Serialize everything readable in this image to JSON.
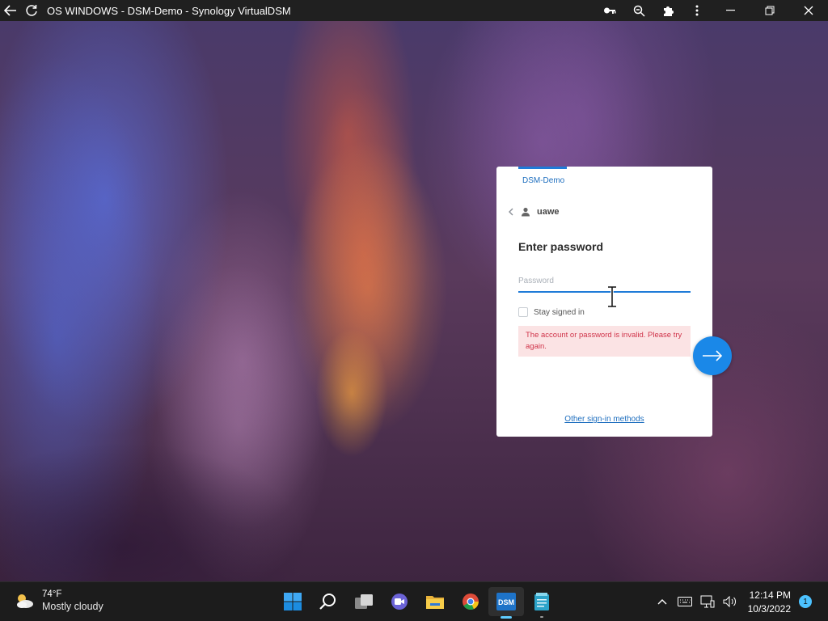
{
  "window": {
    "title": "OS WINDOWS - DSM-Demo - Synology VirtualDSM"
  },
  "titlebar_icons": [
    "back-arrow-icon",
    "reload-icon",
    "key-icon",
    "zoom-icon",
    "extensions-icon",
    "more-icon",
    "minimize-icon",
    "restore-icon",
    "close-icon"
  ],
  "login": {
    "brand": "DSM-Demo",
    "username": "uawe",
    "heading": "Enter password",
    "password_placeholder": "Password",
    "stay_signed_in_label": "Stay signed in",
    "error_message": "The account or password is invalid. Please try again.",
    "other_methods_link": "Other sign-in methods",
    "accent_color": "#1f7bd8",
    "error_color": "#d0344a"
  },
  "taskbar": {
    "weather": {
      "temperature": "74°F",
      "condition": "Mostly cloudy"
    },
    "apps": [
      "start-icon",
      "search-icon",
      "task-view-icon",
      "teams-icon",
      "file-explorer-icon",
      "chrome-icon",
      "dsm-icon",
      "notepad-icon"
    ],
    "dsm_label": "DSM",
    "clock": {
      "time": "12:14 PM",
      "date": "10/3/2022"
    },
    "notification_count": "1"
  }
}
